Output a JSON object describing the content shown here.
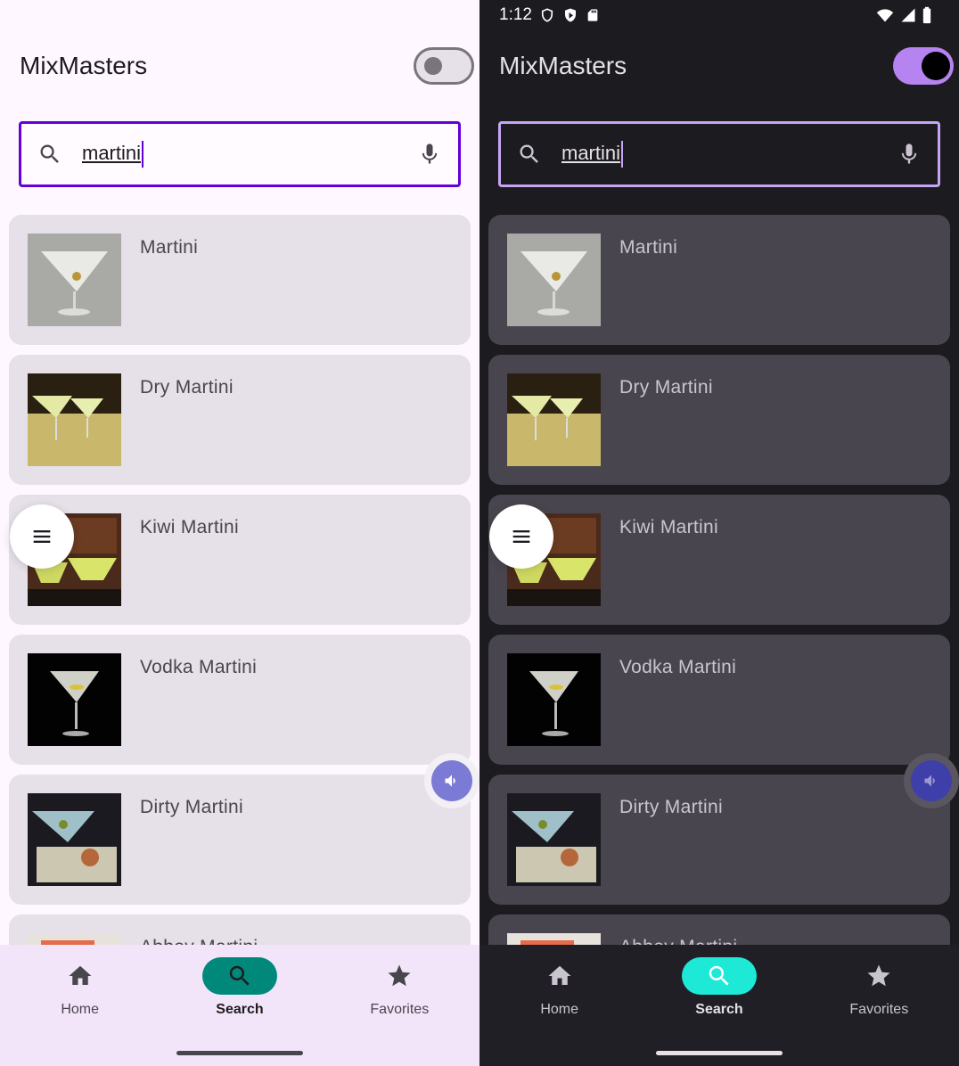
{
  "status": {
    "time": "1:12"
  },
  "app": {
    "title": "MixMasters"
  },
  "theme_toggle": {
    "light_state": "off",
    "dark_state": "on"
  },
  "search": {
    "value": "martini",
    "search_icon": "search-icon",
    "mic_icon": "mic-icon"
  },
  "drinks": [
    {
      "name": "Martini"
    },
    {
      "name": "Dry Martini"
    },
    {
      "name": "Kiwi Martini"
    },
    {
      "name": "Vodka Martini"
    },
    {
      "name": "Dirty Martini"
    },
    {
      "name": "Abbey Martini"
    }
  ],
  "nav": {
    "home": "Home",
    "search": "Search",
    "favorites": "Favorites"
  },
  "colors": {
    "light_accent": "#6200d9",
    "dark_accent": "#c6a6f4",
    "light_nav_active": "#00897b",
    "dark_nav_active": "#1de9d6",
    "dark_toggle": "#b684f0"
  }
}
